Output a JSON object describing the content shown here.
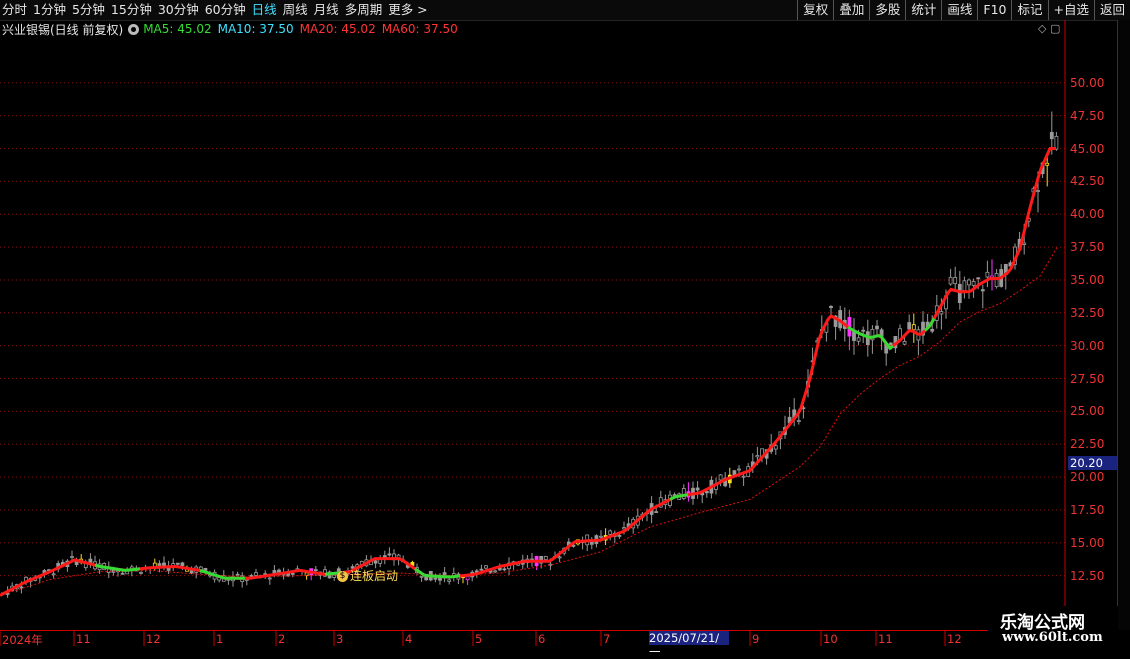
{
  "toolbar": {
    "periods": [
      "分时",
      "1分钟",
      "5分钟",
      "15分钟",
      "30分钟",
      "60分钟",
      "日线",
      "周线",
      "月线",
      "多周期",
      "更多 >"
    ],
    "selected": "日线",
    "buttons": [
      "复权",
      "叠加",
      "多股",
      "统计",
      "画线",
      "F10",
      "标记",
      "+自选",
      "返回"
    ]
  },
  "info": {
    "title": "兴业银锡(日线 前复权)",
    "ma": [
      {
        "label": "MA5: 45.02",
        "color": "#33dd33"
      },
      {
        "label": "MA10: 37.50",
        "color": "#3fe0ff"
      },
      {
        "label": "MA20: 45.02",
        "color": "#ff3333"
      },
      {
        "label": "MA60: 37.50",
        "color": "#ff3333"
      }
    ],
    "corner_icons": "◇ ▢"
  },
  "signal": {
    "icon": "$",
    "label": "连板启动"
  },
  "price_tag": "20.20",
  "date_tag": "2025/07/21/一",
  "watermark": {
    "line1": "乐淘公式网",
    "line2": "www.60lt.com"
  },
  "chart_data": {
    "type": "line",
    "title": "兴业银锡(日线 前复权)",
    "yticks": [
      12.5,
      15.0,
      17.5,
      20.0,
      22.5,
      25.0,
      27.5,
      30.0,
      32.5,
      35.0,
      37.5,
      40.0,
      42.5,
      45.0,
      47.5,
      50.0
    ],
    "ylim": [
      10.8,
      52.8
    ],
    "xticks": [
      "2024年",
      "11",
      "12",
      "1",
      "2",
      "3",
      "4",
      "5",
      "6",
      "7",
      "2025/07/21/一",
      "9",
      "10",
      "11",
      "12"
    ],
    "series": [
      {
        "name": "MA20",
        "color": "#ff2222",
        "x": [
          0,
          25,
          50,
          75,
          100,
          125,
          150,
          175,
          200,
          225,
          250,
          275,
          300,
          325,
          350,
          375,
          400,
          425,
          450,
          475,
          500,
          525,
          550,
          575,
          600,
          625,
          650,
          675,
          700,
          725,
          750,
          775,
          800,
          810,
          820,
          830,
          840,
          850,
          860,
          870,
          880,
          890,
          900,
          910,
          920,
          930,
          940,
          950,
          960,
          970,
          980,
          990,
          1000,
          1010,
          1020,
          1030,
          1040,
          1050,
          1058
        ],
        "values": [
          11.0,
          12.0,
          12.8,
          13.7,
          13.2,
          12.9,
          13.1,
          13.2,
          12.9,
          12.3,
          12.3,
          12.6,
          12.9,
          12.6,
          12.8,
          13.8,
          13.8,
          12.5,
          12.4,
          12.6,
          13.2,
          13.6,
          13.6,
          15.1,
          15.2,
          15.9,
          17.5,
          18.5,
          18.8,
          19.8,
          20.5,
          22.6,
          25.0,
          27.5,
          30.8,
          32.3,
          31.9,
          31.3,
          30.9,
          30.6,
          30.8,
          29.8,
          30.4,
          31.2,
          30.8,
          31.5,
          32.9,
          34.3,
          34.1,
          34.1,
          34.7,
          35.1,
          35.1,
          35.7,
          37.4,
          40.5,
          43.3,
          45.0,
          45.0
        ]
      },
      {
        "name": "MA60",
        "color": "#ff2222",
        "x": [
          0,
          50,
          100,
          150,
          200,
          250,
          300,
          350,
          400,
          450,
          500,
          550,
          600,
          650,
          700,
          750,
          800,
          820,
          840,
          860,
          880,
          900,
          920,
          940,
          960,
          980,
          1000,
          1020,
          1040,
          1058
        ],
        "values": [
          11.0,
          12.2,
          12.8,
          12.9,
          12.6,
          12.4,
          12.5,
          12.6,
          12.7,
          12.5,
          12.7,
          13.3,
          14.3,
          16.2,
          17.3,
          18.3,
          20.8,
          22.3,
          24.8,
          26.3,
          27.5,
          28.5,
          29.2,
          30.3,
          31.8,
          32.6,
          33.2,
          34.2,
          35.3,
          37.6
        ]
      }
    ],
    "highlight_segments": [
      {
        "name": "MA5",
        "color": "#33dd33",
        "x_range": [
          95,
          140
        ]
      },
      {
        "name": "MA5",
        "color": "#33dd33",
        "x_range": [
          200,
          245
        ]
      },
      {
        "name": "MA5",
        "color": "#33dd33",
        "x_range": [
          325,
          345
        ]
      },
      {
        "name": "MA5",
        "color": "#33dd33",
        "x_range": [
          415,
          460
        ]
      },
      {
        "name": "MA5",
        "color": "#33dd33",
        "x_range": [
          670,
          690
        ]
      },
      {
        "name": "MA5",
        "color": "#33dd33",
        "x_range": [
          848,
          895
        ]
      },
      {
        "name": "MA5",
        "color": "#33dd33",
        "x_range": [
          925,
          935
        ]
      }
    ]
  }
}
